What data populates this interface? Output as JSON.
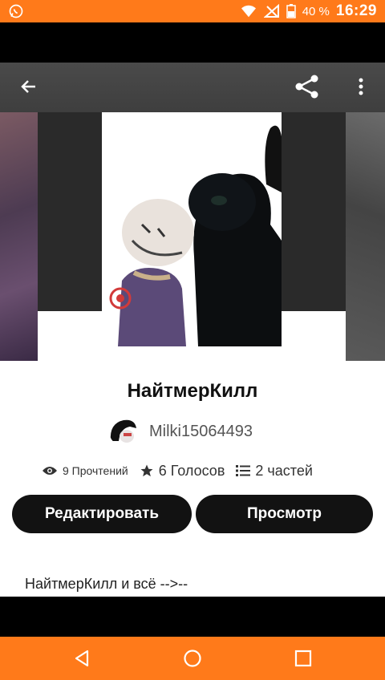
{
  "status_bar": {
    "battery": "40 %",
    "time": "16:29"
  },
  "story": {
    "title": "НайтмерКилл",
    "author": "Milki15064493",
    "reads": "9 Прочтений",
    "votes": "6 Голосов",
    "parts": "2 частей",
    "description": "НайтмерКилл и всё -->--"
  },
  "actions": {
    "edit_label": "Редактировать",
    "view_label": "Просмотр"
  },
  "icons": {
    "status_left": "whatsapp-icon",
    "header": [
      "back-arrow-icon",
      "share-icon",
      "more-vert-icon"
    ],
    "stats": [
      "eye-icon",
      "star-icon",
      "list-icon"
    ],
    "nav": [
      "nav-back-icon",
      "nav-home-icon",
      "nav-recent-icon"
    ]
  },
  "colors": {
    "accent": "#ff7a1a",
    "button_bg": "#121212",
    "button_text": "#ffffff"
  }
}
